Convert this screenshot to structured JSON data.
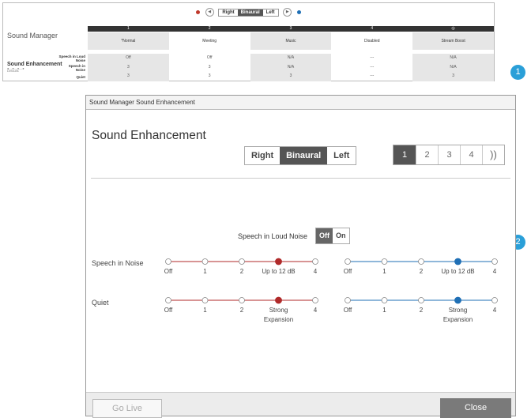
{
  "overview": {
    "ear_options": [
      "Right",
      "Binaural",
      "Left"
    ],
    "ear_selected": "Binaural",
    "title": "Sound Manager",
    "program_numbers": [
      "1",
      "2",
      "3",
      "4",
      "◎"
    ],
    "program_names": [
      "*Normal",
      "Meeting",
      "Music",
      "Disabled",
      "Stream Boost"
    ],
    "section_title": "Sound Enhancement",
    "section_sub": "Defaults",
    "rows": [
      {
        "label": "Speech in Loud Noise",
        "values": [
          "Off",
          "Off",
          "N/A",
          "---",
          "N/A"
        ]
      },
      {
        "label": "Speech in Noise",
        "values": [
          "3",
          "3",
          "N/A",
          "---",
          "N/A"
        ]
      },
      {
        "label": "Quiet",
        "values": [
          "3",
          "3",
          "3",
          "---",
          "3"
        ]
      }
    ],
    "colors": {
      "right": "#c0392b",
      "left": "#1f6fb5"
    }
  },
  "badges": [
    "1",
    "2"
  ],
  "dialog": {
    "window_title": "Sound Manager Sound Enhancement",
    "heading": "Sound Enhancement",
    "ear_options": [
      "Right",
      "Binaural",
      "Left"
    ],
    "ear_selected": "Binaural",
    "programs": [
      "1",
      "2",
      "3",
      "4"
    ],
    "program_selected": "1",
    "stream_icon": "stream-icon",
    "speech_loud_noise": {
      "label": "Speech in Loud Noise",
      "options": [
        "Off",
        "On"
      ],
      "selected": "Off"
    },
    "speech_in_noise": {
      "label": "Speech in Noise",
      "ticks": [
        "Off",
        "1",
        "2",
        "Up to 12 dB",
        "4"
      ],
      "right_selected_index": 3,
      "left_selected_index": 3
    },
    "quiet": {
      "label": "Quiet",
      "ticks": [
        "Off",
        "1",
        "2",
        "Strong Expansion",
        "4"
      ],
      "right_selected_index": 3,
      "left_selected_index": 3
    },
    "go_live": "Go Live",
    "close": "Close",
    "colors": {
      "right": "#b02a2a",
      "left": "#1f6fb5"
    }
  }
}
